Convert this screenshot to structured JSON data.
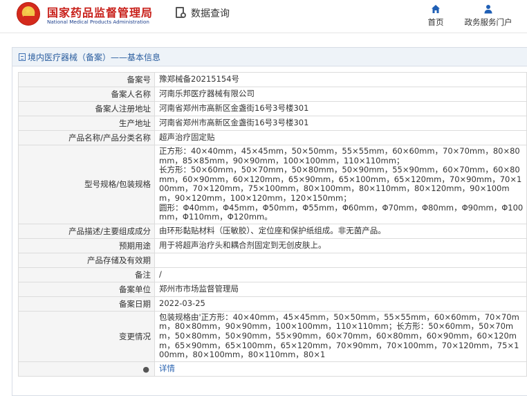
{
  "header": {
    "brand_cn": "国家药品监督管理局",
    "brand_en": "National Medical Products Administration",
    "query_label": "数据查询",
    "nav": [
      {
        "label": "首页",
        "icon": "home-icon"
      },
      {
        "label": "政务服务门户",
        "icon": "user-icon"
      }
    ]
  },
  "breadcrumb": "境内医疗器械（备案）——基本信息",
  "rows": [
    {
      "key": "备案号",
      "value": "豫郑械备20215154号"
    },
    {
      "key": "备案人名称",
      "value": "河南乐邦医疗器械有限公司"
    },
    {
      "key": "备案人注册地址",
      "value": "河南省郑州市高新区金盏街16号3号楼301"
    },
    {
      "key": "生产地址",
      "value": "河南省郑州市高新区金盏街16号3号楼301"
    },
    {
      "key": "产品名称/产品分类名称",
      "value": "超声治疗固定贴"
    },
    {
      "key": "型号规格/包装规格",
      "value": "正方形：40×40mm，45×45mm，50×50mm，55×55mm，60×60mm，70×70mm，80×80mm，85×85mm，90×90mm，100×100mm，110×110mm；\n长方形：50×60mm，50×70mm，50×80mm，50×90mm，55×90mm，60×70mm，60×80mm，60×90mm，60×120mm，65×90mm，65×100mm，65×120mm，70×90mm，70×100mm，70×120mm，75×100mm，80×100mm，80×110mm，80×120mm，90×100mm，90×120mm，100×120mm，120×150mm；\n圆形：Φ40mm，Φ45mm，Φ50mm，Φ55mm，Φ60mm，Φ70mm，Φ80mm，Φ90mm，Φ100mm，Φ110mm，Φ120mm。"
    },
    {
      "key": "产品描述/主要组成成分",
      "value": "由环形黏贴材料（压敏胶）、定位座和保护纸组成。非无菌产品。"
    },
    {
      "key": "预期用途",
      "value": "用于将超声治疗头和耦合剂固定到无创皮肤上。"
    },
    {
      "key": "产品存储及有效期",
      "value": ""
    },
    {
      "key": "备注",
      "value": "/"
    },
    {
      "key": "备案单位",
      "value": "郑州市市场监督管理局"
    },
    {
      "key": "备案日期",
      "value": "2022-03-25"
    },
    {
      "key": "变更情况",
      "value": "包装规格由'正方形：40×40mm，45×45mm，50×50mm，55×55mm，60×60mm，70×70mm，80×80mm，90×90mm，100×100mm，110×110mm；长方形：50×60mm，50×70mm，50×80mm，50×90mm，55×90mm，60×70mm，60×80mm，60×90mm，60×120mm，65×90mm，65×100mm，65×120mm，70×90mm，70×100mm，70×120mm，75×100mm，80×100mm，80×110mm，80×1"
    }
  ],
  "detail_row": {
    "bulb": "●",
    "link": "详情"
  }
}
